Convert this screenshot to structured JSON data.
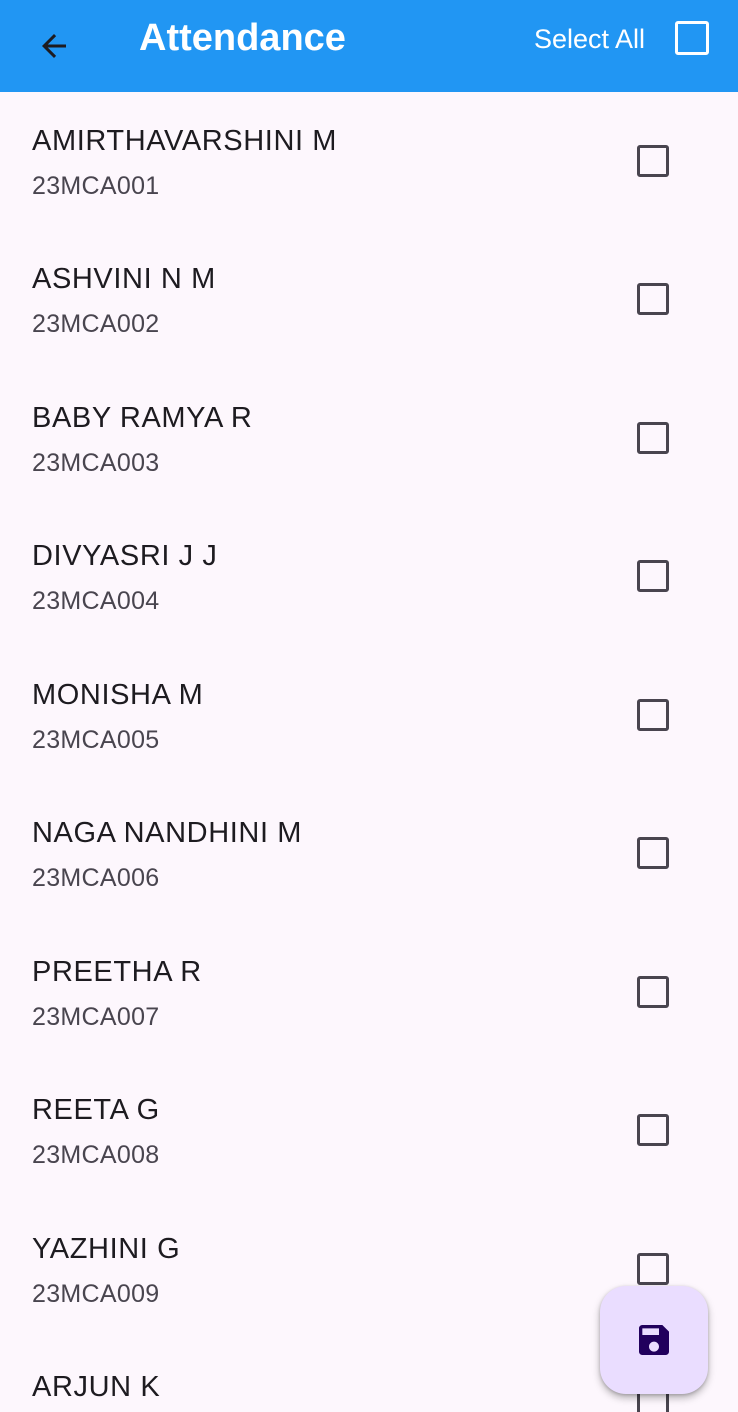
{
  "appbar": {
    "title": "Attendance",
    "back_icon": "arrow-back-icon",
    "select_all_label": "Select All",
    "select_all_checked": false,
    "background_color": "#2196f3"
  },
  "students": [
    {
      "name": "AMIRTHAVARSHINI M",
      "roll": "23MCA001",
      "checked": false
    },
    {
      "name": "ASHVINI N M",
      "roll": "23MCA002",
      "checked": false
    },
    {
      "name": "BABY RAMYA R",
      "roll": "23MCA003",
      "checked": false
    },
    {
      "name": "DIVYASRI J J",
      "roll": "23MCA004",
      "checked": false
    },
    {
      "name": "MONISHA M",
      "roll": "23MCA005",
      "checked": false
    },
    {
      "name": "NAGA NANDHINI M",
      "roll": "23MCA006",
      "checked": false
    },
    {
      "name": "PREETHA R",
      "roll": "23MCA007",
      "checked": false
    },
    {
      "name": "REETA G",
      "roll": "23MCA008",
      "checked": false
    },
    {
      "name": "YAZHINI G",
      "roll": "23MCA009",
      "checked": false
    },
    {
      "name": "ARJUN K",
      "roll": "",
      "checked": false
    }
  ],
  "fab": {
    "icon": "save-icon",
    "background_color": "#eaddff",
    "icon_color": "#21005d"
  }
}
